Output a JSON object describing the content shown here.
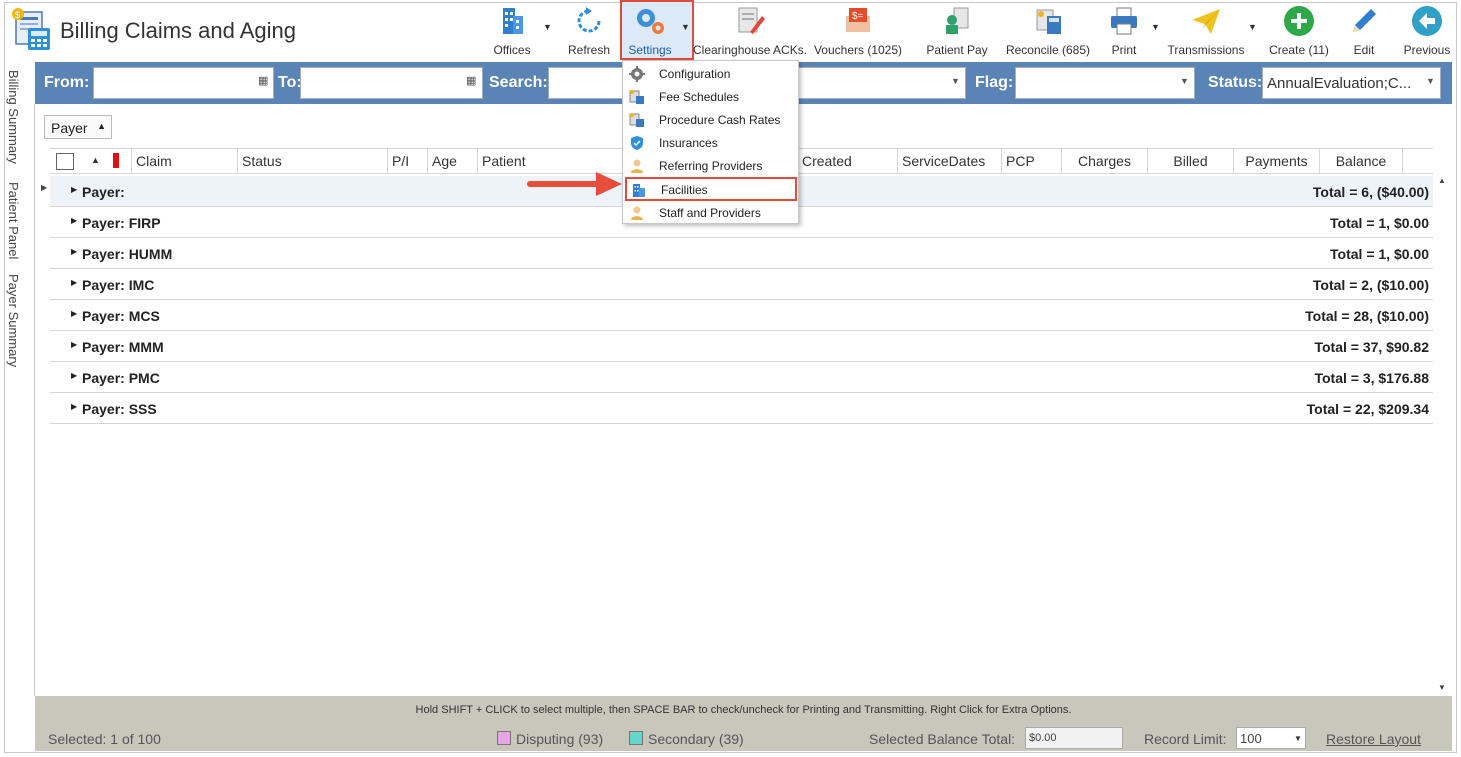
{
  "app": {
    "title": "Billing Claims and Aging"
  },
  "toolbar": {
    "offices": "Offices",
    "refresh": "Refresh",
    "settings": "Settings",
    "clearinghouse": "Clearinghouse ACKs.",
    "vouchers": "Vouchers (1025)",
    "patient_pay": "Patient Pay",
    "reconcile": "Reconcile (685)",
    "print": "Print",
    "transmissions": "Transmissions",
    "create": "Create (11)",
    "edit": "Edit",
    "previous": "Previous"
  },
  "filters": {
    "from_label": "From:",
    "to_label": "To:",
    "search_label": "Search:",
    "flag_label": "Flag:",
    "status_label": "Status:",
    "status_value": "AnnualEvaluation;C..."
  },
  "side_tabs": [
    "Billing Summary",
    "Patient Panel",
    "Payer Summary"
  ],
  "grouping": {
    "group_by": "Payer"
  },
  "grid": {
    "columns": {
      "claim": "Claim",
      "status": "Status",
      "pi": "P/I",
      "age": "Age",
      "patient": "Patient",
      "created": "Created",
      "service_dates": "ServiceDates",
      "pcp": "PCP",
      "charges": "Charges",
      "billed": "Billed",
      "payments": "Payments",
      "balance": "Balance"
    },
    "rows": [
      {
        "label": "Payer:",
        "total": "Total = 6,  ($40.00)"
      },
      {
        "label": "Payer: FIRP",
        "total": "Total = 1,  $0.00"
      },
      {
        "label": "Payer: HUMM",
        "total": "Total = 1,  $0.00"
      },
      {
        "label": "Payer: IMC",
        "total": "Total = 2,  ($10.00)"
      },
      {
        "label": "Payer: MCS",
        "total": "Total = 28,  ($10.00)"
      },
      {
        "label": "Payer: MMM",
        "total": "Total = 37,  $90.82"
      },
      {
        "label": "Payer: PMC",
        "total": "Total = 3,  $176.88"
      },
      {
        "label": "Payer: SSS",
        "total": "Total = 22,  $209.34"
      }
    ]
  },
  "settings_menu": {
    "items": [
      {
        "label": "Configuration",
        "icon": "gear-icon"
      },
      {
        "label": "Fee Schedules",
        "icon": "fee-schedule-icon"
      },
      {
        "label": "Procedure Cash Rates",
        "icon": "cash-rates-icon"
      },
      {
        "label": "Insurances",
        "icon": "shield-icon"
      },
      {
        "label": "Referring Providers",
        "icon": "person-icon"
      },
      {
        "label": "Facilities",
        "icon": "building-icon"
      },
      {
        "label": "Staff and Providers",
        "icon": "staff-icon"
      }
    ],
    "highlighted": "Facilities"
  },
  "footer": {
    "hint": "Hold SHIFT + CLICK to select multiple, then SPACE BAR to check/uncheck for Printing and Transmitting. Right Click for Extra Options.",
    "selected": "Selected: 1 of 100",
    "disputing": "Disputing (93)",
    "secondary": "Secondary (39)",
    "selected_balance_label": "Selected Balance Total:",
    "selected_balance_value": "$0.00",
    "record_limit_label": "Record Limit:",
    "record_limit_value": "100",
    "restore_layout": "Restore Layout"
  },
  "colors": {
    "filter_bar": "#5a84b5",
    "highlight": "#e04b3c",
    "disputing": "#e6a6e6",
    "secondary": "#66d6cc",
    "footer": "#c8c7bc"
  }
}
